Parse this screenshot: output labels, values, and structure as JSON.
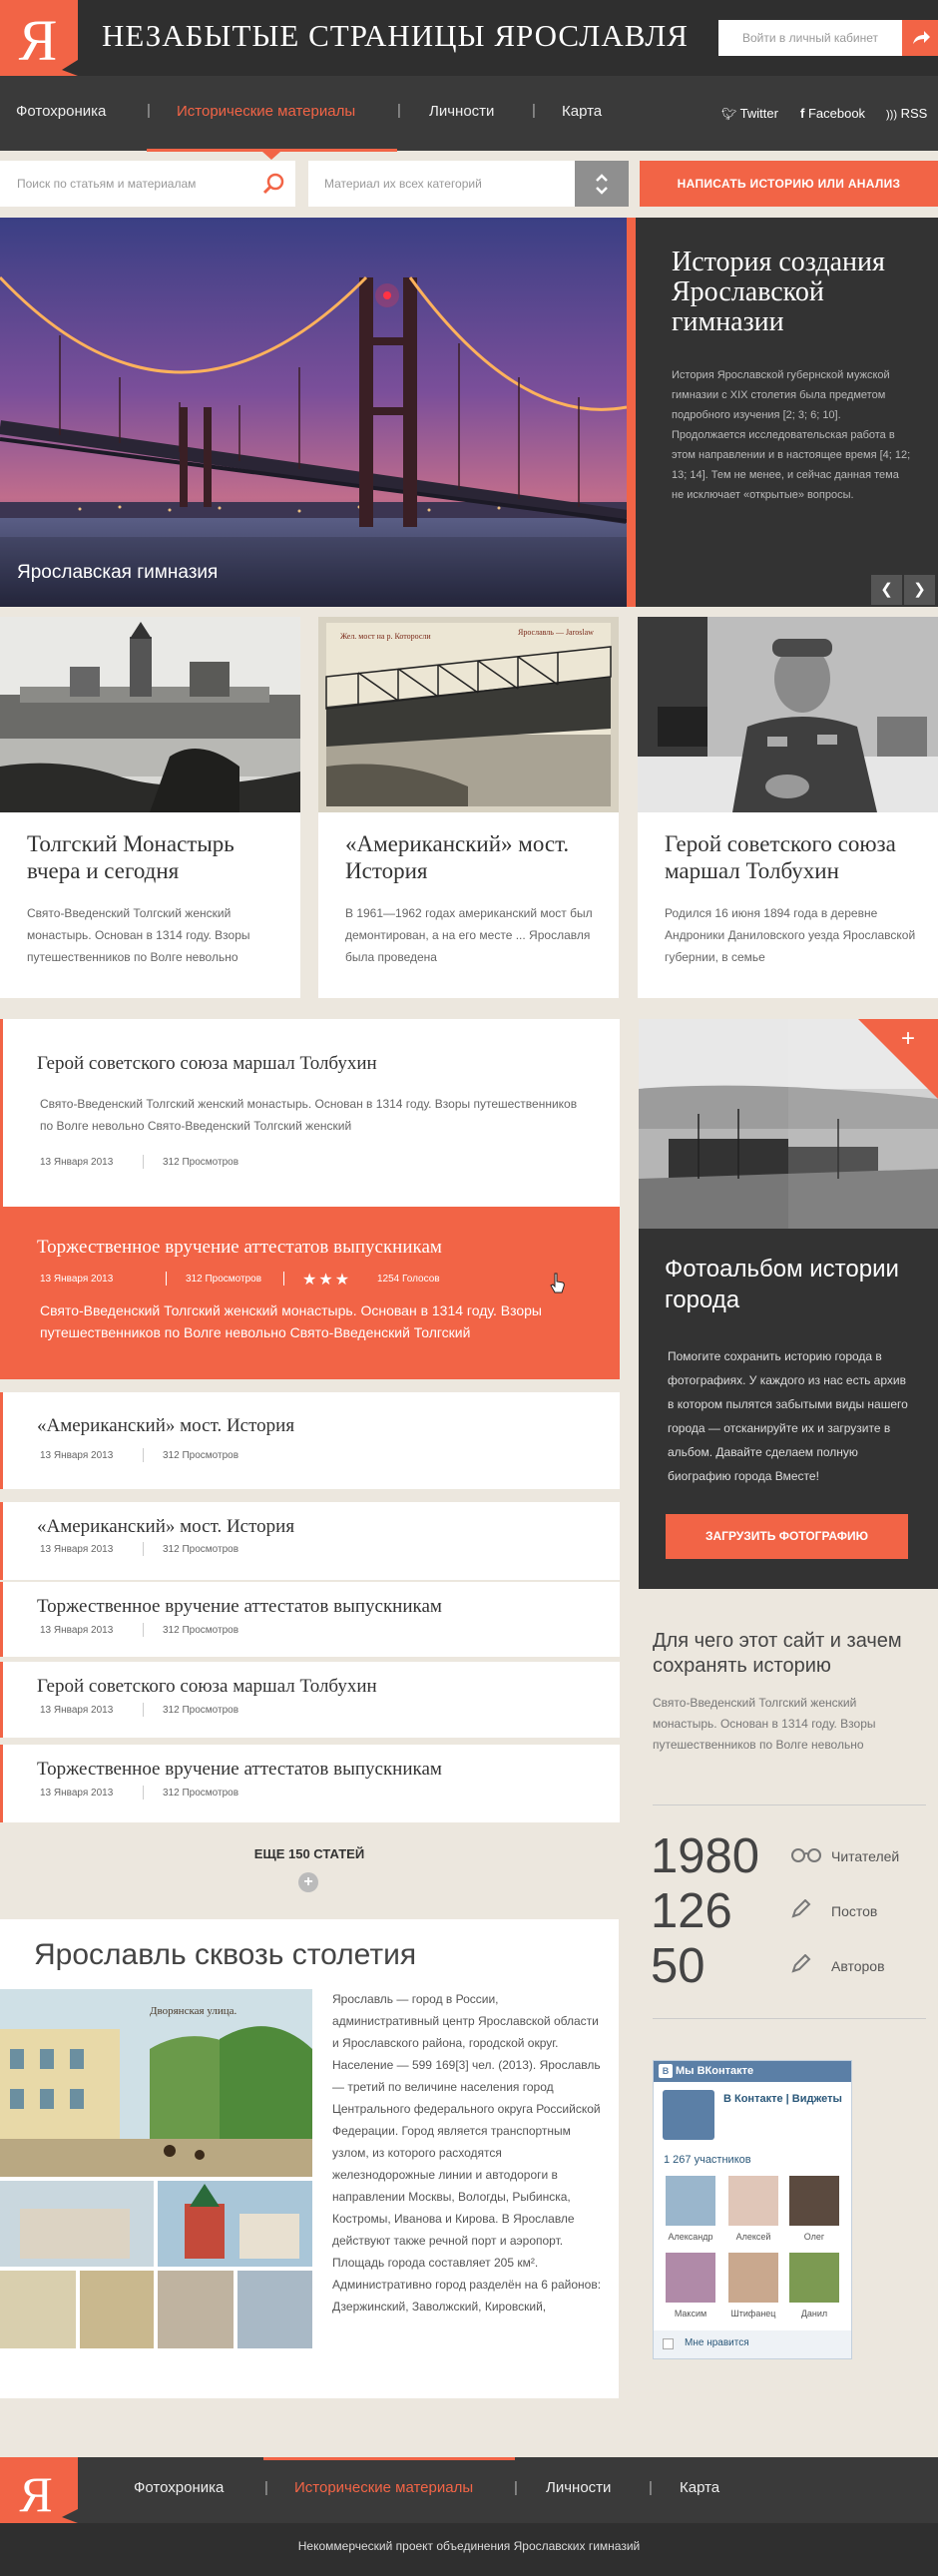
{
  "header": {
    "site_title": "НЕЗАБЫТЫЕ СТРАНИЦЫ ЯРОСЛАВЛЯ",
    "logo_letter": "Я",
    "login_placeholder": "Войти в личный кабинет"
  },
  "nav": {
    "items": [
      "Фотохроника",
      "Исторические материалы",
      "Личности",
      "Карта"
    ],
    "active_index": 1,
    "social": [
      "Twitter",
      "Facebook",
      "RSS"
    ]
  },
  "search": {
    "article_placeholder": "Поиск по статьям и материалам",
    "category_placeholder": "Материал их всех категорий",
    "write_button": "НАПИСАТЬ ИСТОРИЮ ИЛИ АНАЛИЗ"
  },
  "hero": {
    "caption": "Ярославская гимназия",
    "title": "История создания Ярославской гимназии",
    "text": "История Ярославской губернской мужской гимназии с XIX столетия была предметом подробного изучения [2; 3; 6; 10]. Продолжается исследовательская работа в этом направлении и в настоящее время [4; 12; 13; 14]. Тем не менее, и сейчас данная тема не исключает «открытые» вопросы."
  },
  "cards": [
    {
      "title": "Толгский Монастырь вчера и сегодня",
      "text": "Свято-Введенский Толгский женский монастырь. Основан в 1314 году. Взоры путешественников по Волге невольно"
    },
    {
      "title": "«Американский» мост. История",
      "text": "В 1961—1962 годах американский мост был демонтирован, а на его месте ... Ярославля была проведена"
    },
    {
      "title": "Герой советского союза маршал Толбухин",
      "text": "Родился 16 июня 1894 года в деревне Андроники Даниловского уезда Ярославской губернии, в семье"
    }
  ],
  "card_images": {
    "card2_caption_left": "Жел. мост на р. Которосли",
    "card2_caption_right": "Ярославль — Jaroslaw"
  },
  "articles": [
    {
      "title": "Герой советского союза маршал Толбухин",
      "text": "Свято-Введенский Толгский женский монастырь. Основан в 1314 году. Взоры путешественников по Волге невольно  Свято-Введенский Толгский женский",
      "date": "13 Января 2013",
      "views": "312 Просмотров"
    },
    {
      "title": "Торжественное вручение аттестатов выпускникам",
      "text": "Свято-Введенский Толгский женский монастырь. Основан в 1314 году. Взоры путешественников по Волге невольно  Свято-Введенский Толгский",
      "date": "13 Января 2013",
      "views": "312 Просмотров",
      "votes": "1254 Голосов",
      "stars": 3
    },
    {
      "title": "«Американский» мост. История",
      "date": "13 Января 2013",
      "views": "312 Просмотров"
    },
    {
      "title": "«Американский» мост. История",
      "date": "13 Января 2013",
      "views": "312 Просмотров"
    },
    {
      "title": "Торжественное вручение аттестатов выпускникам",
      "date": "13 Января 2013",
      "views": "312 Просмотров"
    },
    {
      "title": "Герой советского союза маршал Толбухин",
      "date": "13 Января 2013",
      "views": "312 Просмотров"
    },
    {
      "title": "Торжественное вручение аттестатов выпускникам",
      "date": "13 Января 2013",
      "views": "312 Просмотров"
    }
  ],
  "more_articles": "ЕЩЕ 150 СТАТЕЙ",
  "album": {
    "title": "Фотоальбом истории города",
    "text": "Помогите сохранить историю города в фотографиях. У каждого из нас есть архив в котором пылятся забытыми виды нашего города — отсканируйте их и загрузите в альбом. Давайте сделаем полную биографию города Вместе!",
    "button": "ЗАГРУЗИТЬ ФОТОГРАФИЮ"
  },
  "why": {
    "title": "Для чего этот сайт и зачем сохранять историю",
    "text": "Свято-Введенский Толгский женский монастырь. Основан в 1314 году. Взоры путешественников по Волге невольно"
  },
  "stats": [
    {
      "value": "1980",
      "label": "Читателей",
      "icon": "glasses-icon"
    },
    {
      "value": "126",
      "label": "Постов",
      "icon": "pencil-icon"
    },
    {
      "value": "50",
      "label": "Авторов",
      "icon": "pencil-icon"
    }
  ],
  "vk": {
    "header": "Мы ВКонтакте",
    "group_name": "В Контакте | Виджеты",
    "members": "1 267 участников",
    "people": [
      "Александр",
      "Алексей",
      "Олег",
      "Максим",
      "Штифанец",
      "Данил"
    ],
    "like": "Мне нравится"
  },
  "yaroslavl": {
    "title": "Ярославль сквозь столетия",
    "image_caption": "Дворянская улица.",
    "text": "Ярославль — город в России, административный центр Ярославской области и Ярославского района, городской округ. Население — 599 169[3] чел. (2013). Ярославль — третий по величине населения город Центрального федерального округа Российской Федерации. Город является транспортным узлом, из которого расходятся железнодорожные линии и автодороги в направлении Москвы, Вологды, Рыбинска, Костромы, Иванова и Кирова. В Ярославле действуют также речной порт и аэропорт. Площадь города составляет 205 км². Административно город разделён на 6 районов: Дзержинский, Заволжский, Кировский,"
  },
  "footer": {
    "nav": [
      "Фотохроника",
      "Исторические материалы",
      "Личности",
      "Карта"
    ],
    "note": "Некоммерческий проект объединения Ярославских гимназий"
  },
  "colors": {
    "accent": "#f26446",
    "dark": "#333333",
    "paper": "#ece7de"
  }
}
